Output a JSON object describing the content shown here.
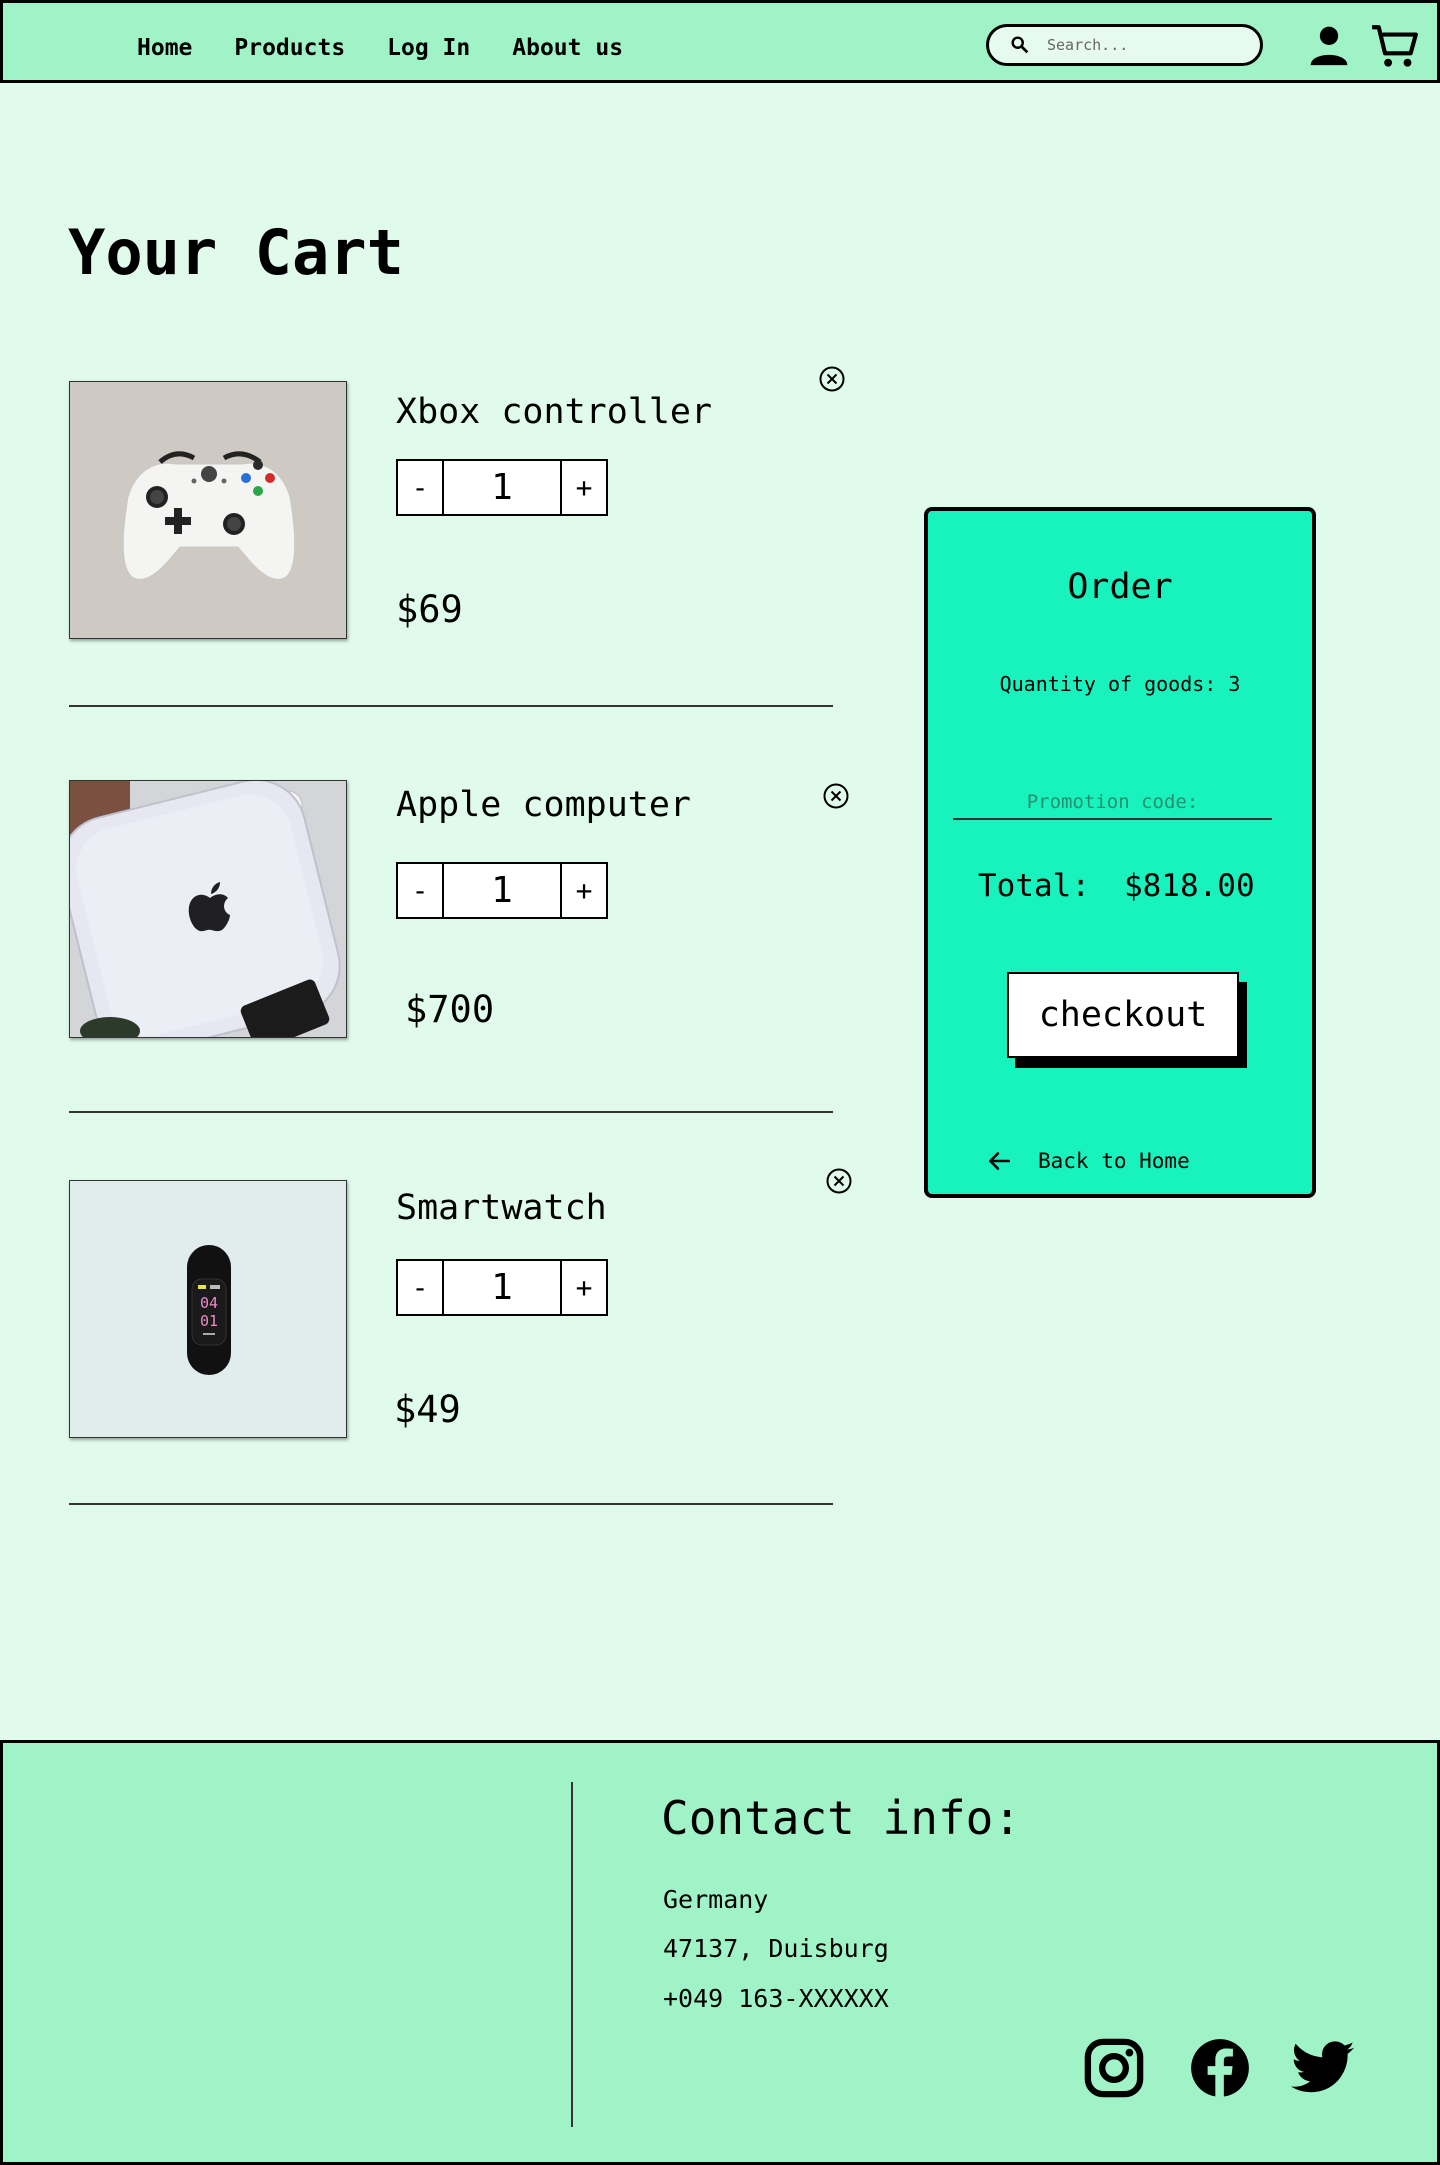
{
  "nav": {
    "items": [
      "Home",
      "Products",
      "Log In",
      "About us"
    ],
    "search_placeholder": "Search..."
  },
  "page_title": "Your Cart",
  "cart": {
    "items": [
      {
        "name": "Xbox controller",
        "quantity": "1",
        "price": "$69",
        "image": "xbox-controller-image"
      },
      {
        "name": "Apple computer",
        "quantity": "1",
        "price": "$700",
        "image": "apple-computer-image"
      },
      {
        "name": "Smartwatch",
        "quantity": "1",
        "price": "$49",
        "image": "smartwatch-image"
      }
    ],
    "decrement_label": "-",
    "increment_label": "+"
  },
  "order": {
    "title": "Order",
    "quantity_text": "Quantity of goods: 3",
    "promo_placeholder": "Promotion code:",
    "total_label": "Total:",
    "total_value": "$818.00",
    "checkout_label": "checkout",
    "back_label": "Back to Home"
  },
  "footer": {
    "contact_title": "Contact info:",
    "country": "Germany",
    "city": "47137, Duisburg",
    "phone": "+049 163-XXXXXX",
    "social": [
      "instagram-icon",
      "facebook-icon",
      "twitter-icon"
    ]
  },
  "colors": {
    "page_bg": "#e0fbeb",
    "header_bg": "#a0f3c6",
    "order_bg": "#18f2bd"
  }
}
